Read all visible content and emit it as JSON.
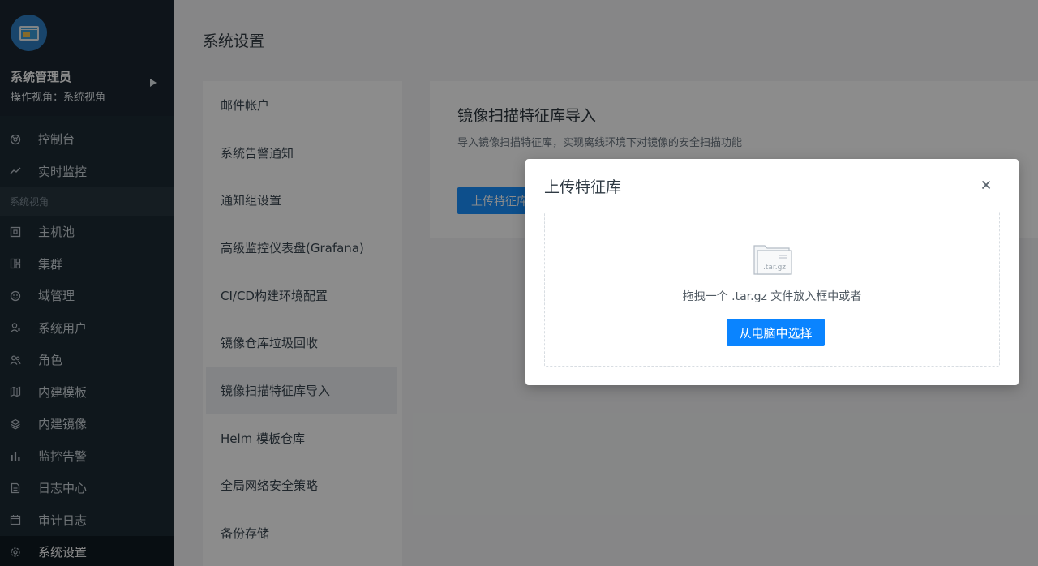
{
  "user": {
    "name": "系统管理员",
    "view": "操作视角：系统视角"
  },
  "nav": {
    "items_top": [
      {
        "label": "控制台",
        "icon": "dashboard-icon"
      },
      {
        "label": "实时监控",
        "icon": "trend-icon"
      }
    ],
    "section_label": "系统视角",
    "items": [
      {
        "label": "主机池",
        "icon": "host-icon"
      },
      {
        "label": "集群",
        "icon": "cluster-icon"
      },
      {
        "label": "域管理",
        "icon": "domain-icon"
      },
      {
        "label": "系统用户",
        "icon": "user-icon"
      },
      {
        "label": "角色",
        "icon": "role-icon"
      },
      {
        "label": "内建模板",
        "icon": "template-icon"
      },
      {
        "label": "内建镜像",
        "icon": "layers-icon"
      },
      {
        "label": "监控告警",
        "icon": "bar-chart-icon"
      },
      {
        "label": "日志中心",
        "icon": "document-icon"
      },
      {
        "label": "审计日志",
        "icon": "calendar-icon"
      },
      {
        "label": "系统设置",
        "icon": "gear-icon"
      }
    ]
  },
  "main": {
    "page_title": "系统设置",
    "settings_menu": [
      "邮件帐户",
      "系统告警通知",
      "通知组设置",
      "高级监控仪表盘(Grafana)",
      "CI/CD构建环境配置",
      "镜像仓库垃圾回收",
      "镜像扫描特征库导入",
      "Helm 模板仓库",
      "全局网络安全策略",
      "备份存储"
    ],
    "content": {
      "title": "镜像扫描特征库导入",
      "description": "导入镜像扫描特征库，实现离线环境下对镜像的安全扫描功能",
      "upload_button": "上传特征库"
    }
  },
  "modal": {
    "title": "上传特征库",
    "file_icon_label": ".tar.gz",
    "drop_text": "拖拽一个 .tar.gz 文件放入框中或者",
    "choose_button": "从电脑中选择"
  },
  "colors": {
    "primary": "#1890ff",
    "sidebar_bg": "#1d2a33"
  }
}
